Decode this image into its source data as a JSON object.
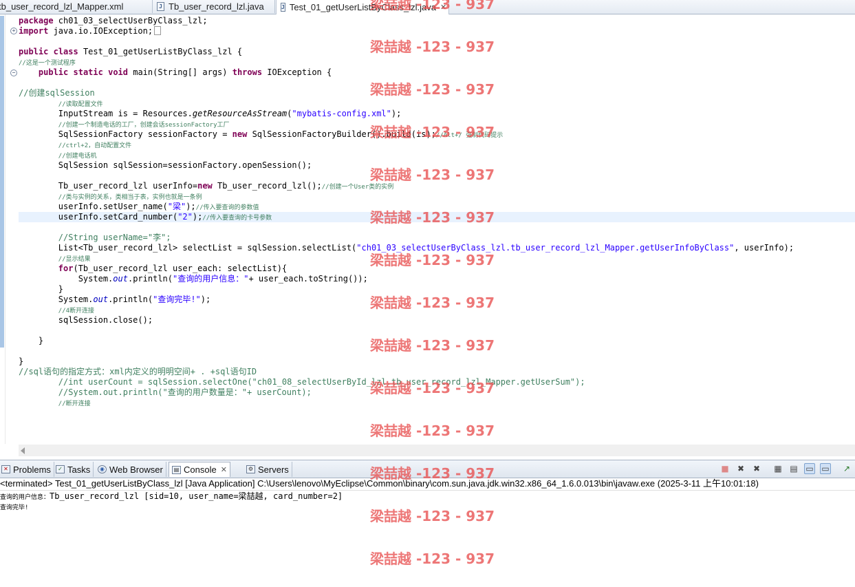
{
  "editor_tabs": [
    {
      "label": "tb_user_record_lzl_Mapper.xml"
    },
    {
      "label": "Tb_user_record_lzl.java"
    },
    {
      "label": "Test_01_getUserListByClass_lzl.java",
      "active": true
    }
  ],
  "code": {
    "l1_kw": "package",
    "l1_rest": " ch01_03_selectUserByClass_lzl;",
    "l2_kw": "import",
    "l2_rest": " java.io.IOException;",
    "l4_kw1": "public",
    "l4_kw2": "class",
    "l4_rest": " Test_01_getUserListByClass_lzl {",
    "l5_cm": "//这是一个测试程序",
    "l6_kw1": "public",
    "l6_kw2": "static",
    "l6_kw3": "void",
    "l6_mid": " main(String[] args) ",
    "l6_kw4": "throws",
    "l6_end": " IOException {",
    "l8_cm": "//创建sqlSession",
    "l9_cm": "//读取配置文件",
    "l10_a": "InputStream is = Resources.",
    "l10_it": "getResourceAsStream",
    "l10_b": "(",
    "l10_str": "\"mybatis-config.xml\"",
    "l10_c": ");",
    "l11_cm": "//创建一个制造电话的工厂，创建会话sessionFactory工厂",
    "l12_a": "SqlSessionFactory sessionFactory = ",
    "l12_kw": "new",
    "l12_b": " SqlSessionFactoryBuilder().build(is);",
    "l12_cm": "//Alt+/ 强制代码提示",
    "l13_cm": "//ctrl+2，自动配置文件",
    "l14_cm": "//创建电话机",
    "l15": "SqlSession sqlSession=sessionFactory.openSession();",
    "l17_a": "Tb_user_record_lzl userInfo=",
    "l17_kw": "new",
    "l17_b": " Tb_user_record_lzl();",
    "l17_cm": "//创建一个User类的实例",
    "l18_cm": "//类与实例的关系，类相当于表，实例也就是一条例",
    "l19_a": "userInfo.setUser_name(",
    "l19_str": "\"梁\"",
    "l19_b": ");",
    "l19_cm": "//传入要查询的参数值",
    "l20_a": "userInfo.setCard_number(",
    "l20_str": "\"2\"",
    "l20_b": ");",
    "l20_cm": "//传入要查询的卡号参数",
    "l22_cm": "//String userName=\"李\";",
    "l23_a": "List<Tb_user_record_lzl> selectList = sqlSession.selectList(",
    "l23_str": "\"ch01_03_selectUserByClass_lzl.tb_user_record_lzl_Mapper.getUserInfoByClass\"",
    "l23_b": ", userInfo);",
    "l24_cm": "//显示结果",
    "l25_kw": "for",
    "l25_rest": "(Tb_user_record_lzl user_each: selectList){",
    "l26_a": "System.",
    "l26_fld": "out",
    "l26_b": ".println(",
    "l26_str": "\"查询的用户信息：\"",
    "l26_c": "+ user_each.toString());",
    "l27": "}",
    "l28_a": "System.",
    "l28_fld": "out",
    "l28_b": ".println(",
    "l28_str": "\"查询完毕!\"",
    "l28_c": ");",
    "l29_cm": "//4断开连接",
    "l30": "sqlSession.close();",
    "l32": "}",
    "l34": "}",
    "l35_cm": "//sql语句的指定方式：xml内定义的明明空间+ . +sql语句ID",
    "l36_cm": "//int userCount = sqlSession.selectOne(\"ch01_08_selectUserById_lzl.tb_user_record_lzl_Mapper.getUserSum\");",
    "l37_cm": "//System.out.println(\"查询的用户数量是：\"+ userCount);",
    "l38_cm": "//断开连接"
  },
  "panel_tabs": [
    {
      "label": "Problems"
    },
    {
      "label": "Tasks"
    },
    {
      "label": "Web Browser"
    },
    {
      "label": "Console",
      "active": true
    },
    {
      "label": "Servers"
    }
  ],
  "console": {
    "header": "<terminated> Test_01_getUserListByClass_lzl [Java Application] C:\\Users\\lenovo\\MyEclipse\\Common\\binary\\com.sun.java.jdk.win32.x86_64_1.6.0.013\\bin\\javaw.exe (2025-3-11 上午10:01:18)",
    "line1_prefix": "查询的用户信息：",
    "line1_rest": "Tb_user_record_lzl [sid=10, user_name=梁喆越, card_number=2]",
    "line2": "查询完毕!"
  },
  "watermark": "梁喆越 -123 - 937",
  "colors": {
    "keyword": "#7f0055",
    "string": "#2a00ff",
    "comment": "#3f7f5f",
    "field": "#0000c0",
    "current_line": "#e8f2fe",
    "watermark": "#e85050"
  }
}
